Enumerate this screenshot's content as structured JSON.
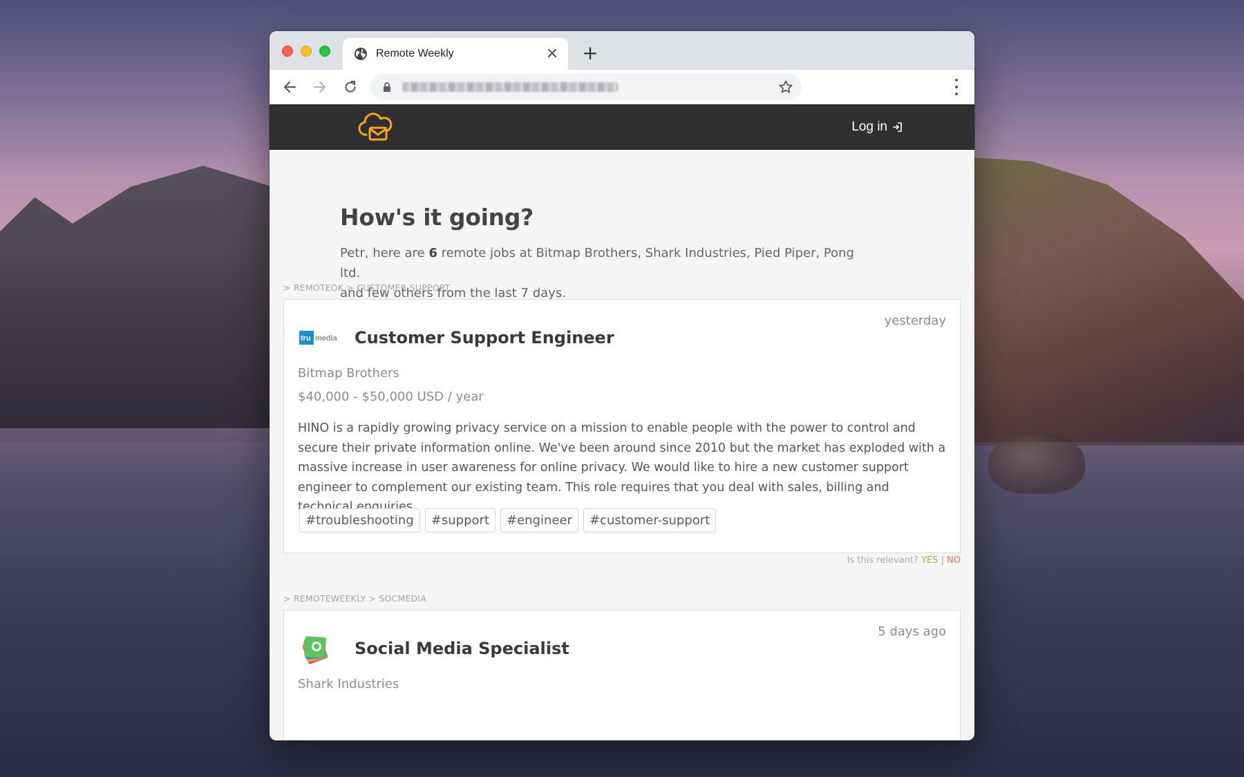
{
  "browser": {
    "tab_title": "Remote Weekly",
    "tab_icon": "globe-icon",
    "new_tab_label": "+",
    "close_label": "×"
  },
  "site": {
    "login_label": "Log in",
    "brand_color": "#f5a623",
    "header_bg": "#2f2f2f"
  },
  "hero": {
    "greeting": "How's it going?",
    "intro_prefix": "Petr, here are ",
    "job_count": "6",
    "intro_suffix": " remote jobs at Bitmap Brothers, Shark Industries, Pied Piper, Pong ltd.",
    "intro_line2": "and few others from the last 7 days."
  },
  "jobs": [
    {
      "breadcrumb": "> REMOTEOK > CUSTOMER SUPPORT",
      "posted": "yesterday",
      "logo_text_a": "tru",
      "logo_text_b": "media",
      "title": "Customer Support Engineer",
      "company": "Bitmap Brothers",
      "salary": "$40,000 - $50,000 USD / year",
      "description": "HINO is a rapidly growing privacy service on a mission to enable people with the power to control and secure their private information online. We've been around since 2010 but the market has exploded with a massive increase in user awareness for online privacy. We would like to hire a new customer support engineer to complement our existing team. This role requires that you deal with sales, billing and technical enquiries.",
      "tags": [
        "#troubleshooting",
        "#support",
        "#engineer",
        "#customer-support"
      ],
      "relevant_q": "Is this relevant?",
      "yes": "YES",
      "sep": "|",
      "no": "NO"
    },
    {
      "breadcrumb": "> REMOTEWEEKLY > SOCMEDIA",
      "posted": "5 days ago",
      "title": "Social Media Specialist",
      "company": "Shark Industries"
    }
  ]
}
